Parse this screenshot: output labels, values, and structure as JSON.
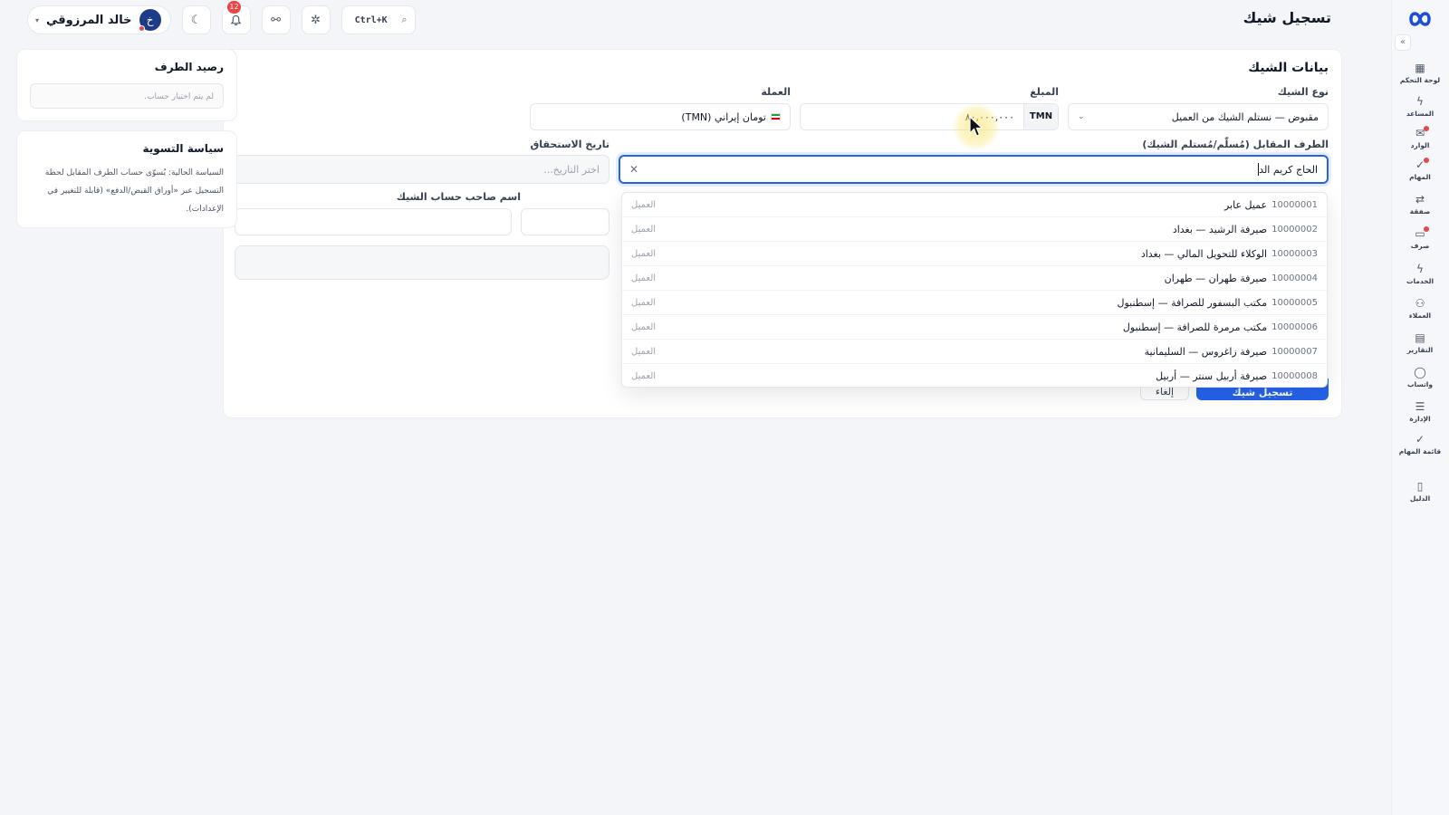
{
  "header": {
    "page_title": "تسجيل شيك",
    "user_name": "خالد المرزوقي",
    "avatar_letter": "خ",
    "notifications_count": "12",
    "search_shortcut": "Ctrl+K"
  },
  "sidebar": {
    "items": [
      {
        "label": "لوحة التحكم",
        "icon": "dashboard-icon",
        "dot": false
      },
      {
        "label": "المساعد",
        "icon": "bolt-icon",
        "dot": false
      },
      {
        "label": "الوارد",
        "icon": "inbox-icon",
        "dot": true
      },
      {
        "label": "المهام",
        "icon": "check-icon",
        "dot": true
      },
      {
        "label": "صفقة",
        "icon": "exchange-icon",
        "dot": false
      },
      {
        "label": "صرف",
        "icon": "cash-icon",
        "dot": true
      },
      {
        "label": "الخدمات",
        "icon": "bolt-icon",
        "dot": false
      },
      {
        "label": "العملاء",
        "icon": "users-icon",
        "dot": false
      },
      {
        "label": "التقارير",
        "icon": "report-icon",
        "dot": false
      },
      {
        "label": "واتساب",
        "icon": "chat-icon",
        "dot": false
      },
      {
        "label": "الإدارة",
        "icon": "sliders-icon",
        "dot": false
      },
      {
        "label": "قائمة المهام",
        "icon": "checklist-icon",
        "dot": false
      },
      {
        "label": "الدليل",
        "icon": "book-icon",
        "dot": false
      }
    ]
  },
  "form": {
    "title": "بيانات الشيك",
    "check_type": {
      "label": "نوع الشيك",
      "value": "مقبوض — نستلم الشيك من العميل"
    },
    "amount": {
      "label": "المبلغ",
      "value": "٨٠,٠٠٠,٠٠٠",
      "currency_code": "TMN"
    },
    "currency": {
      "label": "العملة",
      "value": "تومان إيراني (TMN)"
    },
    "counterparty": {
      "label": "الطرف المقابل (مُسلّم/مُستلم الشيك)",
      "value": "الحاج كريم الد"
    },
    "due_date": {
      "label": "تاريخ الاستحقاق",
      "placeholder": "اختر التاريخ..."
    },
    "account_holder": {
      "label": "اسم صاحب حساب الشيك"
    },
    "submit_label": "تسجيل شيك",
    "cancel_label": "إلغاء"
  },
  "dropdown": {
    "options": [
      {
        "code": "10000001",
        "name": "عميل عابر",
        "type": "العميل"
      },
      {
        "code": "10000002",
        "name": "صيرفة الرشيد — بغداد",
        "type": "العميل"
      },
      {
        "code": "10000003",
        "name": "الوكلاء للتحويل المالي — بغداد",
        "type": "العميل"
      },
      {
        "code": "10000004",
        "name": "صيرفة طهران — طهران",
        "type": "العميل"
      },
      {
        "code": "10000005",
        "name": "مكتب البسفور للصرافة — إسطنبول",
        "type": "العميل"
      },
      {
        "code": "10000006",
        "name": "مكتب مرمرة للصرافة — إسطنبول",
        "type": "العميل"
      },
      {
        "code": "10000007",
        "name": "صيرفة زاغروس — السليمانية",
        "type": "العميل"
      },
      {
        "code": "10000008",
        "name": "صيرفة أربيل سنتر — أربيل",
        "type": "العميل"
      }
    ]
  },
  "balance_card": {
    "title": "رصيد الطرف",
    "placeholder": "لم يتم اختيار حساب."
  },
  "policy_card": {
    "title": "سياسة التسوية",
    "lines": [
      "السياسة الحالية: يُسوّى حساب الطرف المقابل لحظة",
      "التسجيل عبر «أوراق القبض/الدفع» (قابلة للتغيير في",
      "الإعدادات)."
    ]
  },
  "colors": {
    "primary": "#2563eb",
    "badge": "#ef4444",
    "background": "#f3f5f9"
  }
}
